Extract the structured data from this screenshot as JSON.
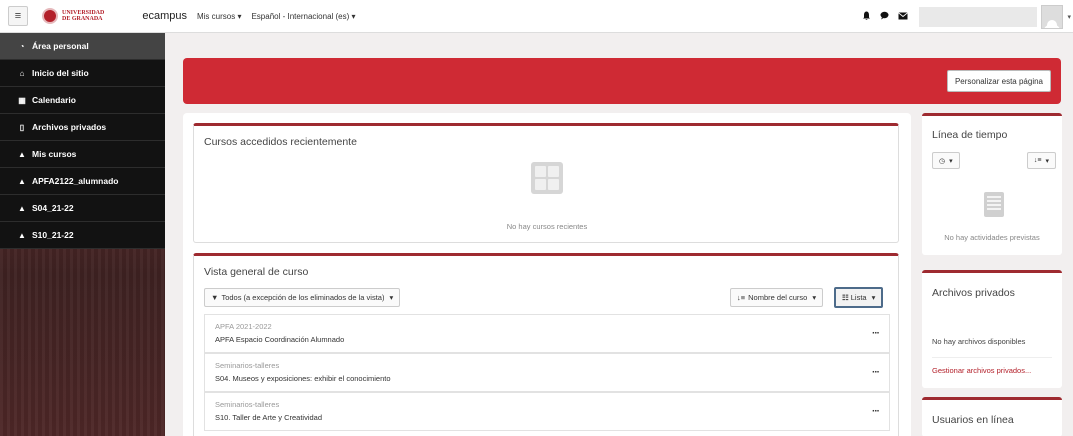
{
  "navbar": {
    "menu_icon": "hamburger-icon",
    "logo_text_line1": "UNIVERSIDAD",
    "logo_text_line2": "DE GRANADA",
    "brand": "ecampus",
    "links": [
      {
        "label": "Mis cursos"
      },
      {
        "label": "Español - Internacional (es)"
      }
    ],
    "icons": [
      "bell-icon",
      "chat-icon",
      "mail-icon"
    ]
  },
  "sidebar": {
    "items": [
      {
        "label": "Área personal",
        "icon": "dashboard-icon",
        "active": true
      },
      {
        "label": "Inicio del sitio",
        "icon": "home-icon"
      },
      {
        "label": "Calendario",
        "icon": "calendar-icon"
      },
      {
        "label": "Archivos privados",
        "icon": "file-icon"
      },
      {
        "label": "Mis cursos",
        "icon": "graduation-cap-icon"
      },
      {
        "label": "APFA2122_alumnado",
        "icon": "graduation-cap-icon"
      },
      {
        "label": "S04_21-22",
        "icon": "graduation-cap-icon"
      },
      {
        "label": "S10_21-22",
        "icon": "graduation-cap-icon"
      }
    ]
  },
  "header": {
    "customize_button": "Personalizar esta página",
    "banner_color": "#cf2a34"
  },
  "recent": {
    "title": "Cursos accedidos recientemente",
    "empty_text": "No hay cursos recientes"
  },
  "overview": {
    "title": "Vista general de curso",
    "filter_label": "Todos (a excepción de los eliminados de la vista)",
    "sort_label": "Nombre del curso",
    "view_label": "Lista",
    "courses": [
      {
        "category": "APFA 2021-2022",
        "name": "APFA Espacio Coordinación Alumnado"
      },
      {
        "category": "Seminarios-talleres",
        "name": "S04. Museos y exposiciones: exhibir el conocimiento"
      },
      {
        "category": "Seminarios-talleres",
        "name": "S10. Taller de Arte y Creatividad"
      }
    ]
  },
  "timeline": {
    "title": "Línea de tiempo",
    "empty_text": "No hay actividades previstas"
  },
  "private_files": {
    "title": "Archivos privados",
    "empty_text": "No hay archivos disponibles",
    "manage_link": "Gestionar archivos privados..."
  },
  "online_users": {
    "title": "Usuarios en línea"
  },
  "colors": {
    "accent": "#9e2a30",
    "sidebar_bg": "#121212",
    "link": "#b3202a"
  }
}
